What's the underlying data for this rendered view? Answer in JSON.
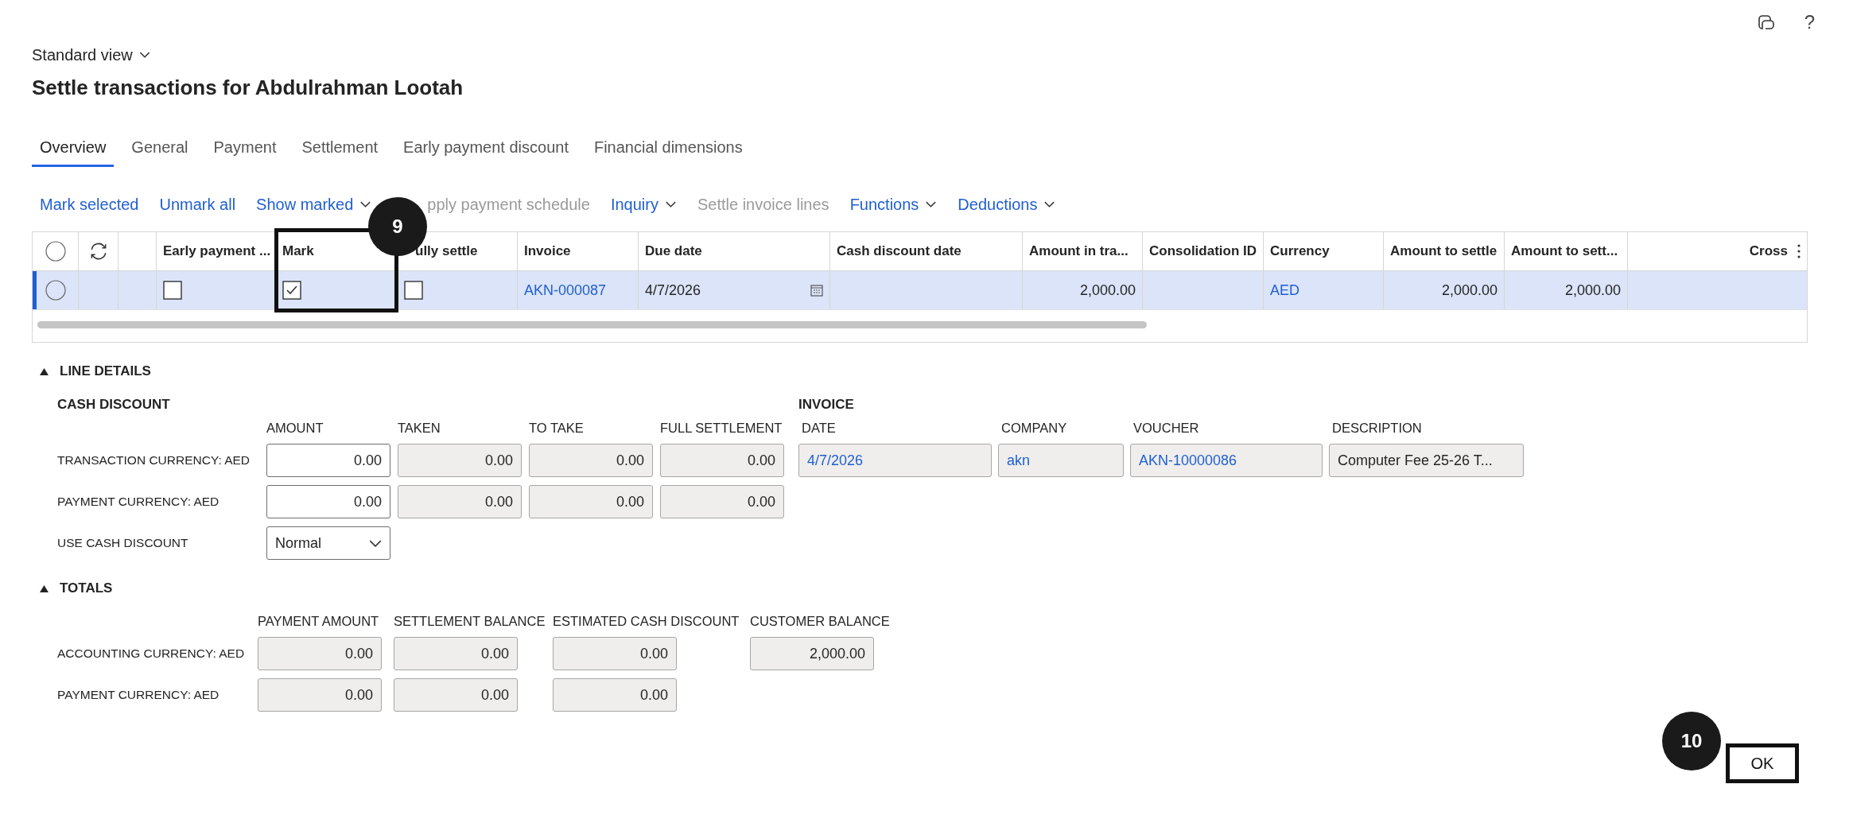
{
  "top_bar": {
    "help": "?"
  },
  "view_selector": "Standard view",
  "title": "Settle transactions for Abdulrahman Lootah",
  "tabs": [
    {
      "label": "Overview",
      "selected": true
    },
    {
      "label": "General",
      "selected": false
    },
    {
      "label": "Payment",
      "selected": false
    },
    {
      "label": "Settlement",
      "selected": false
    },
    {
      "label": "Early payment discount",
      "selected": false
    },
    {
      "label": "Financial dimensions",
      "selected": false
    }
  ],
  "toolbar": [
    {
      "label": "Mark selected",
      "disabled": false,
      "dropdown": false
    },
    {
      "label": "Unmark all",
      "disabled": false,
      "dropdown": false
    },
    {
      "label": "Show marked",
      "disabled": false,
      "dropdown": true
    },
    {
      "label": "pply payment schedule",
      "disabled": true,
      "dropdown": false
    },
    {
      "label": "Inquiry",
      "disabled": false,
      "dropdown": true
    },
    {
      "label": "Settle invoice lines",
      "disabled": true,
      "dropdown": false
    },
    {
      "label": "Functions",
      "disabled": false,
      "dropdown": true
    },
    {
      "label": "Deductions",
      "disabled": false,
      "dropdown": true
    }
  ],
  "grid": {
    "all_selected": false,
    "columns": [
      {
        "kind": "radio"
      },
      {
        "kind": "refresh"
      },
      {
        "kind": "blank"
      },
      {
        "kind": "text",
        "label": "Early payment ..."
      },
      {
        "kind": "text",
        "label": "Mark"
      },
      {
        "kind": "text",
        "label": "ully settle"
      },
      {
        "kind": "text",
        "label": "Invoice"
      },
      {
        "kind": "text",
        "label": "Due date"
      },
      {
        "kind": "text",
        "label": "Cash discount date"
      },
      {
        "kind": "text",
        "label": "Amount in tra..."
      },
      {
        "kind": "text",
        "label": "Consolidation ID"
      },
      {
        "kind": "text",
        "label": "Currency"
      },
      {
        "kind": "text",
        "label": "Amount to settle"
      },
      {
        "kind": "text",
        "label": "Amount to sett..."
      },
      {
        "kind": "menu",
        "label": "Cross"
      }
    ],
    "rows": [
      {
        "selected": true,
        "cells": [
          {
            "kind": "radio"
          },
          {
            "kind": "blank"
          },
          {
            "kind": "blank"
          },
          {
            "kind": "checkbox",
            "checked": false
          },
          {
            "kind": "checkbox",
            "checked": true
          },
          {
            "kind": "checkbox",
            "checked": false
          },
          {
            "kind": "link",
            "text": "AKN-000087"
          },
          {
            "kind": "date",
            "text": "4/7/2026"
          },
          {
            "kind": "blank"
          },
          {
            "kind": "number",
            "text": "2,000.00"
          },
          {
            "kind": "blank"
          },
          {
            "kind": "link",
            "text": "AED"
          },
          {
            "kind": "number",
            "text": "2,000.00"
          },
          {
            "kind": "number",
            "text": "2,000.00"
          },
          {
            "kind": "blank"
          }
        ]
      }
    ]
  },
  "line_details": {
    "title": "LINE DETAILS",
    "expanded": true,
    "cash_discount": {
      "title": "CASH DISCOUNT",
      "columns": [
        "AMOUNT",
        "TAKEN",
        "TO TAKE",
        "FULL SETTLEMENT"
      ],
      "rows": [
        {
          "label": "TRANSACTION CURRENCY: AED",
          "values": [
            {
              "value": "0.00",
              "editable": true
            },
            {
              "value": "0.00",
              "editable": false
            },
            {
              "value": "0.00",
              "editable": false
            },
            {
              "value": "0.00",
              "editable": false
            }
          ]
        },
        {
          "label": "PAYMENT CURRENCY: AED",
          "values": [
            {
              "value": "0.00",
              "editable": true
            },
            {
              "value": "0.00",
              "editable": false
            },
            {
              "value": "0.00",
              "editable": false
            },
            {
              "value": "0.00",
              "editable": false
            }
          ]
        }
      ],
      "use_cash_discount": {
        "label": "USE CASH DISCOUNT",
        "value": "Normal"
      }
    },
    "invoice": {
      "title": "INVOICE",
      "fields": [
        {
          "label": "DATE",
          "value": "4/7/2026",
          "link": true
        },
        {
          "label": "COMPANY",
          "value": "akn",
          "link": true
        },
        {
          "label": "VOUCHER",
          "value": "AKN-10000086",
          "link": true
        },
        {
          "label": "DESCRIPTION",
          "value": "Computer Fee 25-26 T...",
          "link": false
        }
      ]
    }
  },
  "totals": {
    "title": "TOTALS",
    "expanded": true,
    "columns": [
      "PAYMENT AMOUNT",
      "SETTLEMENT BALANCE",
      "ESTIMATED CASH DISCOUNT",
      "CUSTOMER BALANCE"
    ],
    "rows": [
      {
        "label": "ACCOUNTING CURRENCY: AED",
        "values": [
          "0.00",
          "0.00",
          "0.00",
          "2,000.00"
        ]
      },
      {
        "label": "PAYMENT CURRENCY: AED",
        "values": [
          "0.00",
          "0.00",
          "0.00"
        ]
      }
    ]
  },
  "ok_button": "OK",
  "callouts": [
    "9",
    "10"
  ]
}
